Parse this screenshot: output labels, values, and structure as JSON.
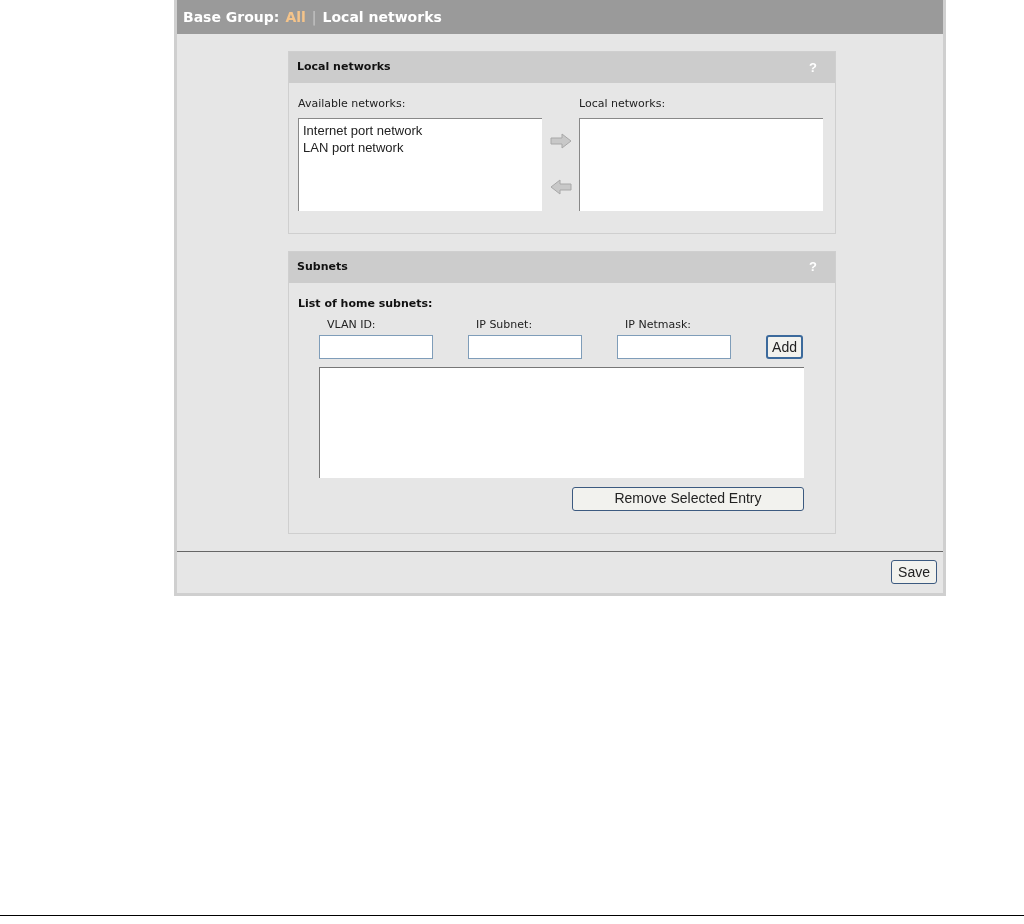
{
  "breadcrumb": {
    "prefix": "Base Group:",
    "link": "All",
    "separator": "|",
    "current": "Local networks"
  },
  "local_networks_panel": {
    "title": "Local networks",
    "help": "?",
    "available_label": "Available networks:",
    "available_items": [
      "Internet port network",
      "LAN port network"
    ],
    "local_label": "Local networks:"
  },
  "subnets_panel": {
    "title": "Subnets",
    "help": "?",
    "list_label": "List of home subnets:",
    "fields": [
      {
        "label": "VLAN ID:"
      },
      {
        "label": "IP Subnet:"
      },
      {
        "label": "IP Netmask:"
      }
    ],
    "add_button": "Add",
    "remove_button": "Remove Selected Entry"
  },
  "save_button": "Save"
}
